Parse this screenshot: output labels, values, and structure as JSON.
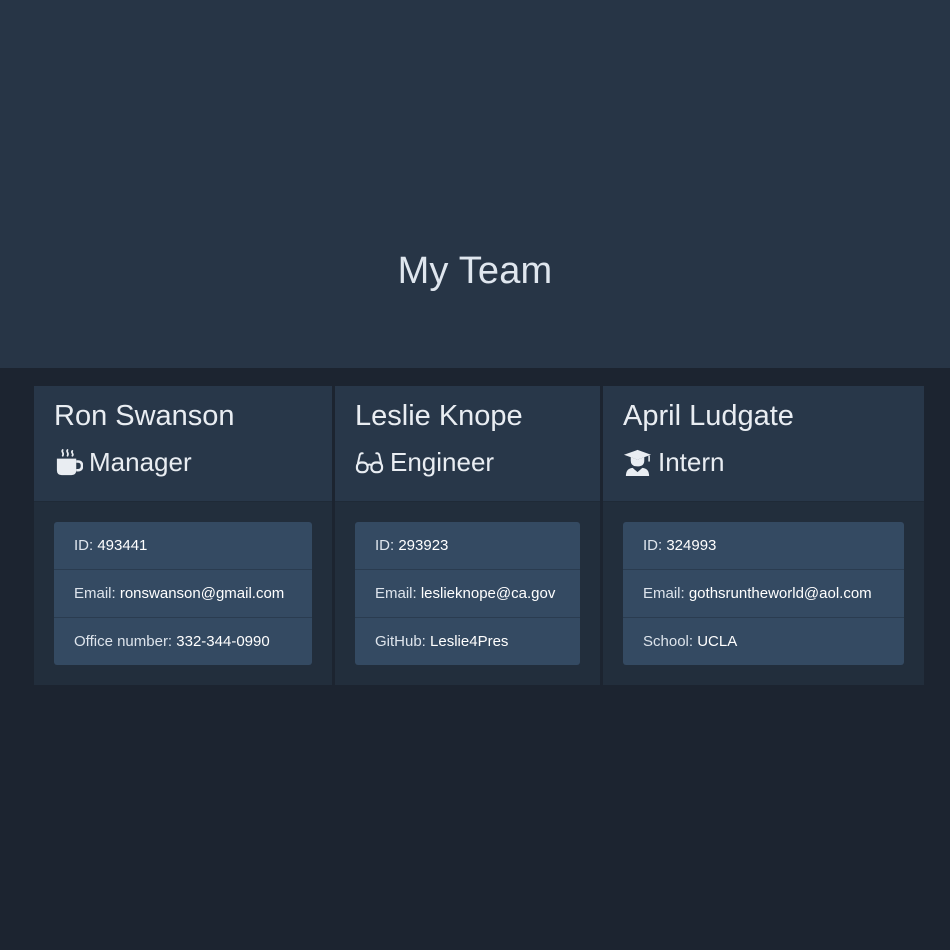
{
  "page": {
    "title": "My Team"
  },
  "colors": {
    "page_background": "#1c2430",
    "header_background": "#273546",
    "card_background": "#222e3c",
    "card_header_background": "#283749",
    "detail_background": "#344a62"
  },
  "team": [
    {
      "name": "Ron Swanson",
      "role": "Manager",
      "role_icon": "mug-icon",
      "details": [
        {
          "label": "ID: ",
          "value": "493441"
        },
        {
          "label": "Email: ",
          "value": "ronswanson@gmail.com"
        },
        {
          "label": "Office number: ",
          "value": "332-344-0990"
        }
      ]
    },
    {
      "name": "Leslie Knope",
      "role": "Engineer",
      "role_icon": "glasses-icon",
      "details": [
        {
          "label": "ID: ",
          "value": "293923"
        },
        {
          "label": "Email: ",
          "value": "leslieknope@ca.gov"
        },
        {
          "label": "GitHub: ",
          "value": "Leslie4Pres"
        }
      ]
    },
    {
      "name": "April Ludgate",
      "role": "Intern",
      "role_icon": "graduate-icon",
      "details": [
        {
          "label": "ID: ",
          "value": "324993"
        },
        {
          "label": "Email: ",
          "value": "gothsruntheworld@aol.com"
        },
        {
          "label": "School: ",
          "value": "UCLA"
        }
      ]
    }
  ]
}
